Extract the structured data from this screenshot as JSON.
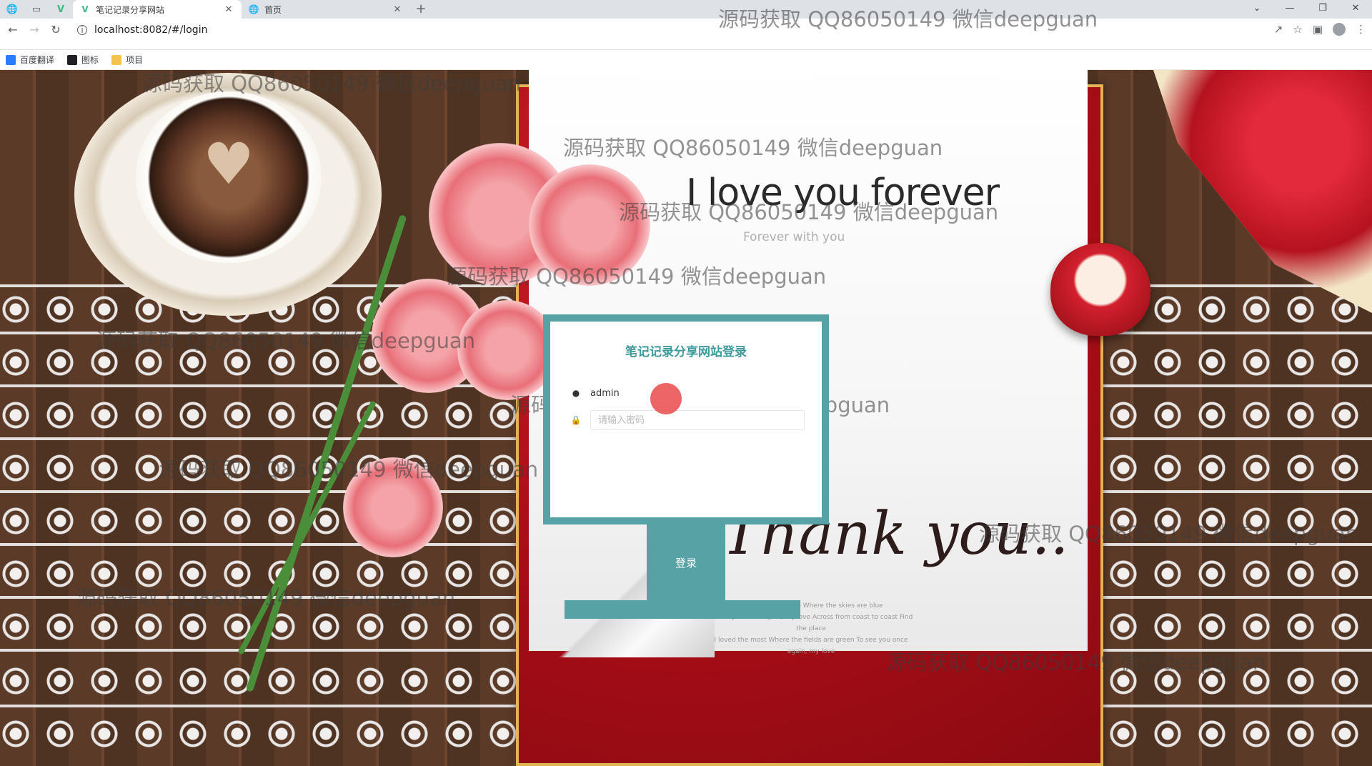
{
  "browser": {
    "tabs": [
      {
        "title": "笔记记录分享网站",
        "active": true
      },
      {
        "title": "首页",
        "active": false
      }
    ],
    "address": "localhost:8082/#/login",
    "bookmarks": [
      "百度翻译",
      "图标",
      "项目"
    ]
  },
  "background": {
    "card_title": "I love you forever",
    "card_subtitle": "Forever with you",
    "card_thanks": "Thank you..",
    "card_thanks_small": "I will take me there Where the skies are blue\nTo see you once again, my love Across from coast to coast Find the place\nI loved the most Where the fields are green To see you once again, my love"
  },
  "login": {
    "title": "笔记记录分享网站登录",
    "username_value": "admin",
    "password_placeholder": "请输入密码",
    "submit_label": "登录"
  },
  "watermark_text": "源码获取 QQ86050149 微信deepguan",
  "colors": {
    "accent": "#56a2a4",
    "title_teal": "#3f9a9b",
    "frame_red": "#a80d16",
    "frame_gold": "#e3b456"
  }
}
